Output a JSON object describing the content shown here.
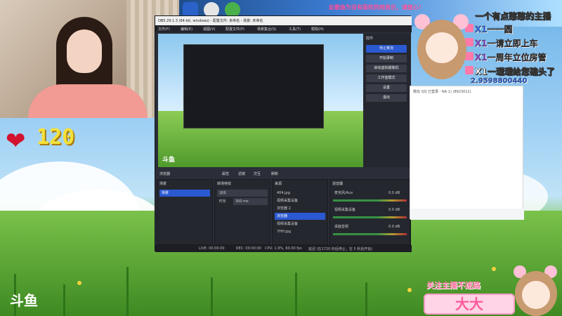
{
  "stream": {
    "gift_count": "120",
    "watermark": "斗鱼",
    "top_marquee": "此歌曲为没有版权的纯音乐，请放心！",
    "streamer_name": "大大",
    "follow_text": "关注主播不迷路"
  },
  "danmaku": [
    {
      "text": "一个有点憨憨的主播",
      "color": "white"
    },
    {
      "text": "X1一一圆",
      "color": "blue"
    },
    {
      "text": "X1一请立即上车",
      "color": "purple"
    },
    {
      "text": "X1一周年立位房管",
      "color": "purple"
    },
    {
      "text": "X1一理理给您磕头了",
      "color": "white"
    },
    {
      "text": "2.9598800440",
      "color": "blue"
    }
  ],
  "obs": {
    "window_title": "OBS 29.1.3 (64-bit, windows) - 配置文件: 未命名 - 场景: 未命名",
    "menu": [
      "文件(F)",
      "编辑(E)",
      "视图(V)",
      "配置文件(P)",
      "场景集合(S)",
      "工具(T)",
      "帮助(H)"
    ],
    "controls_title": "控件",
    "controls": [
      "停止推流",
      "开始录制",
      "启动虚拟摄像机",
      "工作室模式",
      "设置",
      "退出"
    ],
    "toolbar": {
      "browser": "浏览器",
      "props": "属性",
      "filters": "滤镜",
      "interact": "交互",
      "refresh": "刷新"
    },
    "scenes_title": "场景",
    "scenes": [
      "场景"
    ],
    "transitions_title": "转场特效",
    "transition_value": "淡出",
    "duration_label": "时长",
    "duration_value": "300 ms",
    "sources_title": "来源",
    "sources": [
      "404.jpg",
      "视频采集设备",
      "浏览器 2",
      "浏览器",
      "视频采集设备",
      "7HH.jpg"
    ],
    "mixer_title": "混音器",
    "mixer": [
      {
        "name": "麦克风/Aux",
        "db": "0.0 dB"
      },
      {
        "name": "视频采集设备",
        "db": "0.0 dB"
      },
      {
        "name": "桌面音频",
        "db": "0.0 dB"
      }
    ],
    "status": {
      "live": "LIVE: 00:00:00",
      "rec": "REC: 00:00:00",
      "cpu": "CPU: 1.9%, 60.00 fps",
      "delay": "延迟 (在1720 秒后停止，在 5 秒后开始)"
    }
  },
  "chat": {
    "line1": "微信 QQ 已登录 - NA 1) (8923012)"
  },
  "colors": {
    "obs_bg": "#2b2e38",
    "accent": "#2b59d1",
    "gift": "#f4e03a",
    "heart": "#d3122d",
    "pink": "#ff5a9c"
  }
}
